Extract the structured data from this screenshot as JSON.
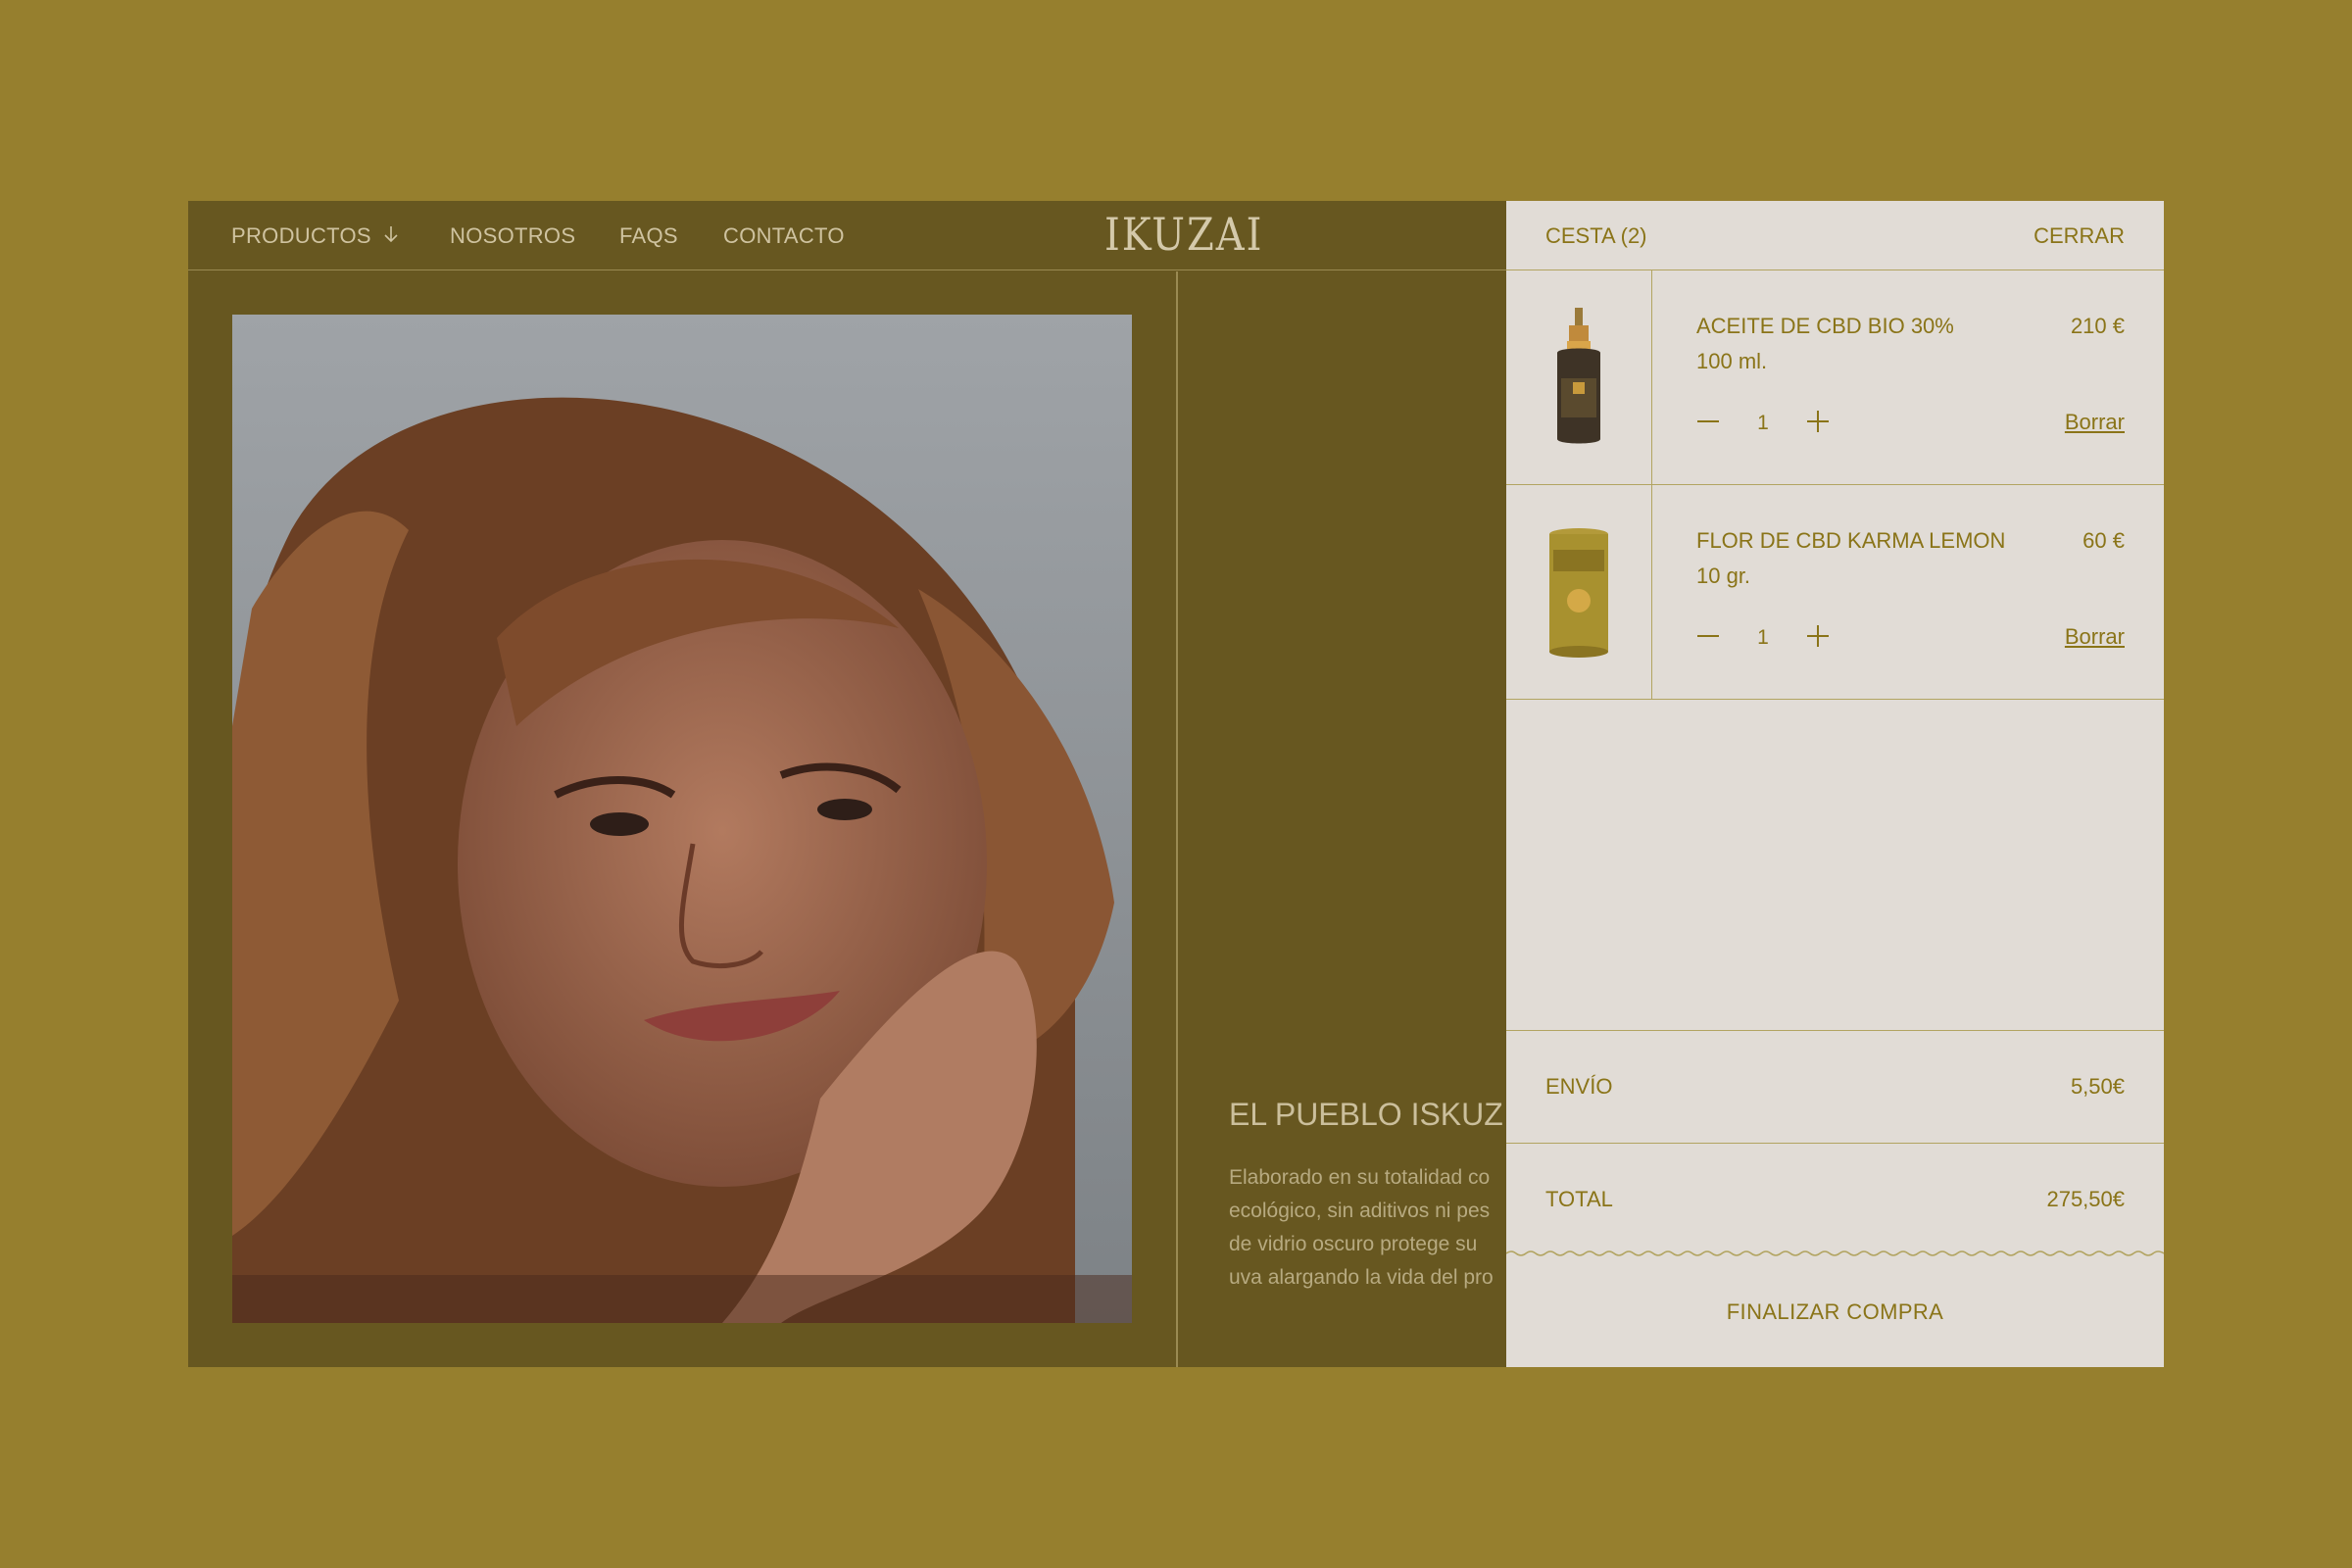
{
  "nav": {
    "items": [
      "PRODUCTOS",
      "NOSOTROS",
      "FAQS",
      "CONTACTO"
    ],
    "logo": "IKUZAI"
  },
  "story": {
    "title": "EL PUEBLO ISKUZ",
    "lines": [
      "Elaborado en su totalidad co",
      "ecológico, sin aditivos ni pes",
      "de vidrio oscuro protege su",
      "uva alargando la vida del pro"
    ]
  },
  "cart": {
    "title": "CESTA (2)",
    "close": "CERRAR",
    "items": [
      {
        "name": "ACEITE DE CBD BIO 30%",
        "size": "100 ml.",
        "price": "210 €",
        "qty": "1",
        "remove": "Borrar"
      },
      {
        "name": "FLOR DE CBD KARMA LEMON",
        "size": "10 gr.",
        "price": "60 €",
        "qty": "1",
        "remove": "Borrar"
      }
    ],
    "shipping_label": "ENVÍO",
    "shipping_value": "5,50€",
    "total_label": "TOTAL",
    "total_value": "275,50€",
    "checkout": "FINALIZAR COMPRA"
  },
  "colors": {
    "background": "#967f2e",
    "frame": "#675720",
    "cart_bg": "#e1dcd6",
    "accent": "#8a7418"
  }
}
